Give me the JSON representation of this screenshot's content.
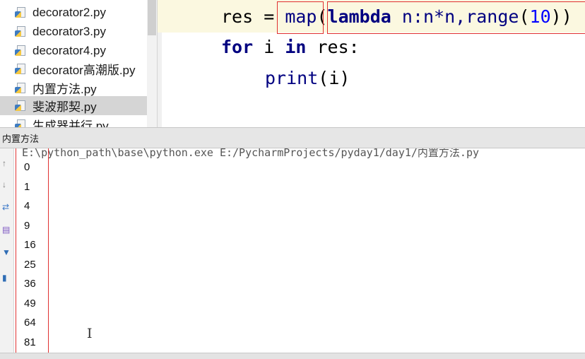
{
  "tree": {
    "items": [
      {
        "label": "decorator2.py"
      },
      {
        "label": "decorator3.py"
      },
      {
        "label": "decorator4.py"
      },
      {
        "label": "decorator高潮版.py"
      },
      {
        "label": "内置方法.py"
      },
      {
        "label": "斐波那契.py"
      },
      {
        "label": "生成器并行.py"
      }
    ],
    "selected_index": 5
  },
  "editor": {
    "line1": {
      "var": "res",
      "eq": " = ",
      "map": "map",
      "paren_open": "(",
      "lambda": "lambda",
      "lambda_body": " n:n*n,",
      "range": "range",
      "range_open": "(",
      "range_arg": "10",
      "range_close": "))"
    },
    "line2": {
      "kw_for": "for",
      "i": " i ",
      "kw_in": "in",
      "rest": " res:"
    },
    "line3": {
      "print": "print",
      "args": "(i)"
    }
  },
  "run": {
    "title": "内置方法",
    "command": "E:\\python_path\\base\\python.exe E:/PycharmProjects/pyday1/day1/内置方法.py",
    "output": [
      "0",
      "1",
      "4",
      "9",
      "16",
      "25",
      "36",
      "49",
      "64",
      "81"
    ]
  },
  "icons": {
    "file": "python-file-icon",
    "toolbar": [
      "up-arrow-icon",
      "down-arrow-icon",
      "rerun-icon",
      "filter-icon",
      "pin-icon",
      "trash-icon"
    ]
  },
  "colors": {
    "annotation": "#e03030",
    "keyword": "#000080",
    "number": "#0000ff",
    "caret_line": "#fbf8e0"
  }
}
